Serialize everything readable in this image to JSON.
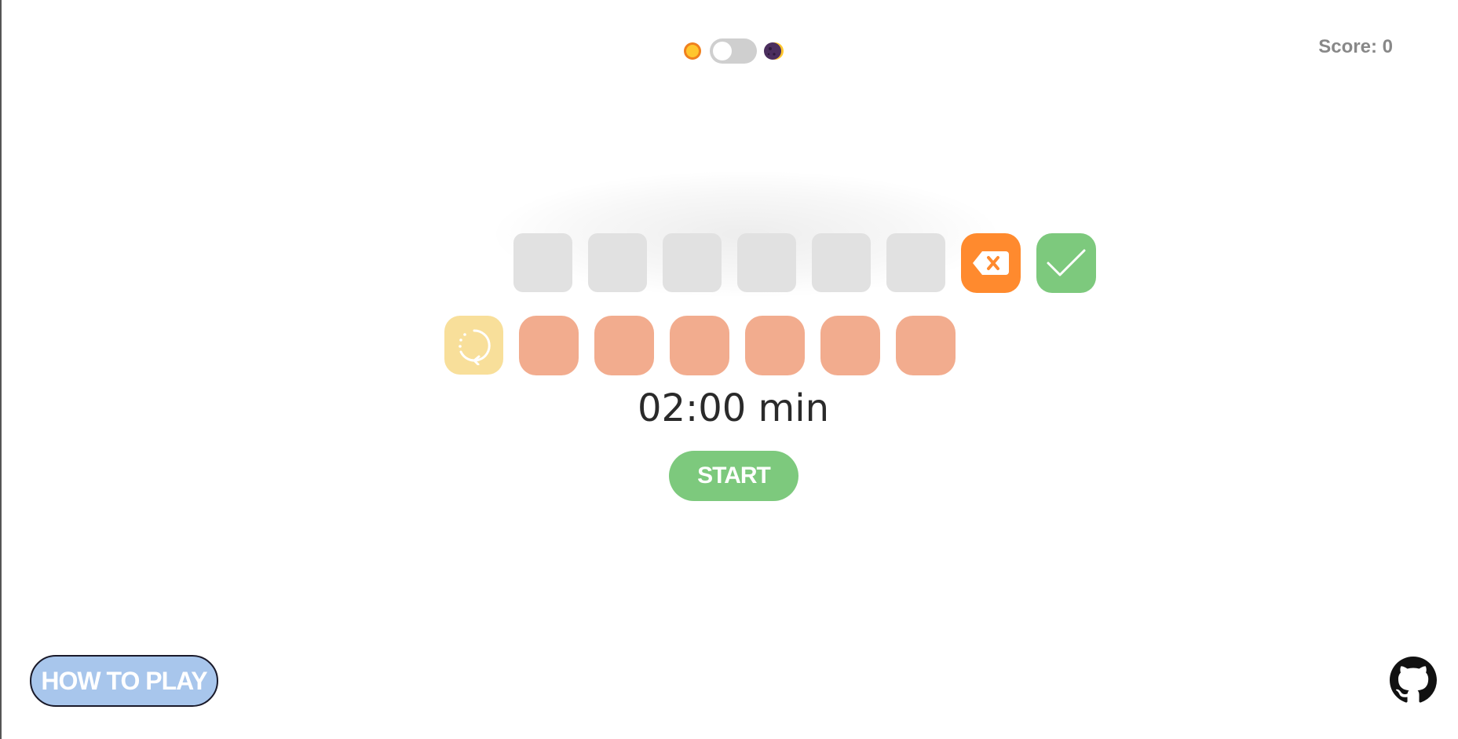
{
  "header": {
    "theme_toggle": {
      "light_icon": "sun-icon",
      "dark_icon": "moon-icon",
      "state": "light"
    },
    "score_label": "Score: 0"
  },
  "answer": {
    "slots": [
      "",
      "",
      "",
      "",
      "",
      ""
    ],
    "delete_icon": "backspace-icon",
    "submit_icon": "check-icon"
  },
  "letters": {
    "shuffle_icon": "shuffle-icon",
    "tiles": [
      "",
      "",
      "",
      "",
      "",
      ""
    ]
  },
  "timer": "02:00 min",
  "start_label": "START",
  "how_to_play_label": "HOW TO PLAY",
  "github_icon": "github-icon",
  "colors": {
    "slot": "#e1e1e1",
    "delete": "#ff8a2e",
    "submit": "#7dc97d",
    "shuffle": "#f8df9a",
    "tile": "#f2ac8e",
    "start": "#7dc97d",
    "how_to_play": "#a8c6ec",
    "score_text": "#888888"
  }
}
